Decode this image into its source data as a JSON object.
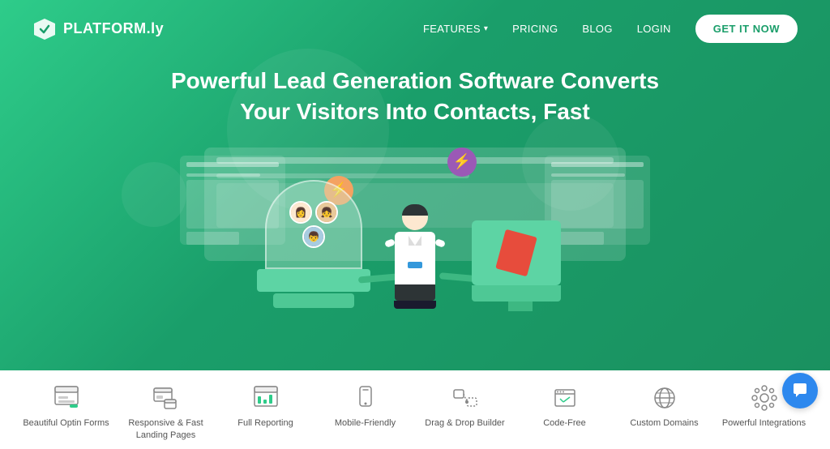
{
  "brand": {
    "logo_text": "PLATFORM.ly",
    "logo_icon": "shield"
  },
  "navbar": {
    "links": [
      {
        "label": "FEATURES",
        "has_dropdown": true
      },
      {
        "label": "PRICING",
        "has_dropdown": false
      },
      {
        "label": "BLOG",
        "has_dropdown": false
      },
      {
        "label": "LOGIN",
        "has_dropdown": false
      }
    ],
    "cta_label": "GET IT NOW"
  },
  "hero": {
    "title": "Powerful Lead Generation Software Converts Your Visitors Into Contacts, Fast"
  },
  "features": [
    {
      "id": "optin-forms",
      "label": "Beautiful Optin Forms",
      "icon": "form"
    },
    {
      "id": "landing-pages",
      "label": "Responsive & Fast Landing Pages",
      "icon": "pages"
    },
    {
      "id": "reporting",
      "label": "Full Reporting",
      "icon": "chart"
    },
    {
      "id": "mobile",
      "label": "Mobile-Friendly",
      "icon": "mobile"
    },
    {
      "id": "drag-drop",
      "label": "Drag & Drop Builder",
      "icon": "drag"
    },
    {
      "id": "code-free",
      "label": "Code-Free",
      "icon": "tag"
    },
    {
      "id": "domains",
      "label": "Custom Domains",
      "icon": "globe"
    },
    {
      "id": "integrations",
      "label": "Powerful Integrations",
      "icon": "integrations"
    }
  ],
  "colors": {
    "primary_green": "#2ecc8a",
    "dark_green": "#1a9e6a",
    "white": "#ffffff",
    "purple": "#9b59b6",
    "orange": "#f4a261",
    "chat_blue": "#2d88ee"
  }
}
